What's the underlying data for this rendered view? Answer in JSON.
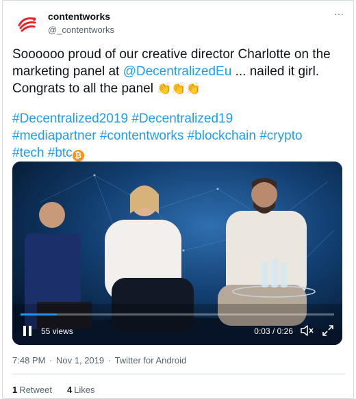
{
  "author": {
    "name": "contentworks",
    "handle": "@_contentworks",
    "more_glyph": "···"
  },
  "tweet": {
    "line1_pre": "Soooooo proud of our creative director Charlotte on the marketing panel at ",
    "mention": "@DecentralizedEu",
    "line1_post": " ... nailed it girl. Congrats to all the panel ",
    "clap_emoji": "👏👏👏",
    "hashtags": [
      "#Decentralized2019",
      "#Decentralized19",
      "#mediapartner",
      "#contentworks",
      "#blockchain",
      "#crypto",
      "#tech",
      "#btc"
    ],
    "btc_icon": "bitcoin-icon",
    "btc_glyph": "₿"
  },
  "video": {
    "views": "55 views",
    "time": "0:03 / 0:26",
    "progress": 0.115,
    "accent": "#1d9bf0"
  },
  "meta": {
    "time": "7:48 PM",
    "date": "Nov 1, 2019",
    "source": "Twitter for Android",
    "separator": "·"
  },
  "stats": {
    "retweets_count": "1",
    "retweets_label": "Retweet",
    "likes_count": "4",
    "likes_label": "Likes"
  },
  "colors": {
    "link": "#1d9bf0",
    "text": "#0f1419",
    "muted": "#536471",
    "border": "#cfd9de"
  }
}
